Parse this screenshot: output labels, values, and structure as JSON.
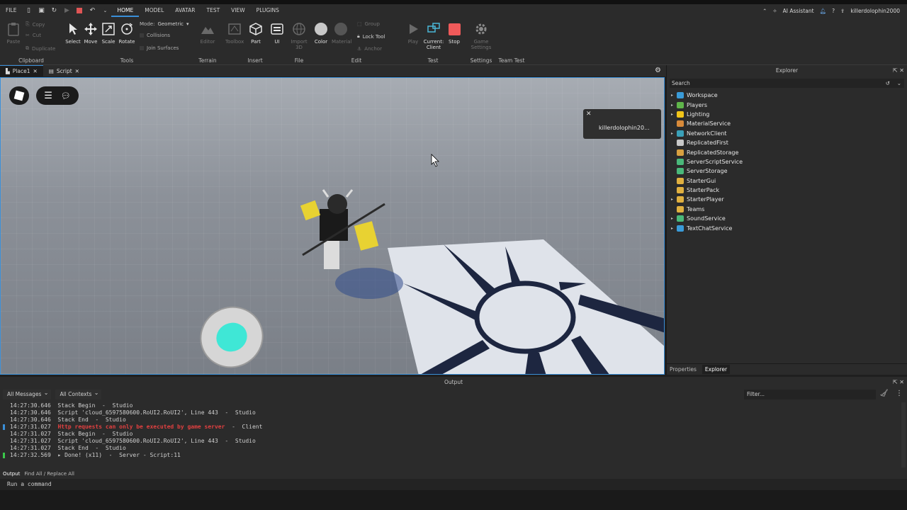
{
  "menu": {
    "file": "FILE",
    "tabs": [
      "HOME",
      "MODEL",
      "AVATAR",
      "TEST",
      "VIEW",
      "PLUGINS"
    ],
    "ai_assistant": "AI Assistant",
    "username": "killerdolophin2000"
  },
  "ribbon": {
    "clipboard": {
      "label": "Clipboard",
      "paste": "Paste",
      "copy": "Copy",
      "cut": "Cut",
      "duplicate": "Duplicate"
    },
    "tools": {
      "label": "Tools",
      "select": "Select",
      "move": "Move",
      "scale": "Scale",
      "rotate": "Rotate",
      "mode_label": "Mode:",
      "mode_value": "Geometric",
      "collisions": "Collisions",
      "join_surfaces": "Join Surfaces"
    },
    "terrain": {
      "label": "Terrain",
      "editor": "Editor"
    },
    "insert": {
      "label": "Insert",
      "toolbox": "Toolbox",
      "part": "Part",
      "ui": "UI"
    },
    "file": {
      "label": "File",
      "import3d": "Import 3D"
    },
    "edit": {
      "label": "Edit",
      "color": "Color",
      "material": "Material",
      "group": "Group",
      "lock_tool": "Lock Tool",
      "anchor": "Anchor"
    },
    "test": {
      "label": "Test",
      "play": "Play",
      "current": "Current:",
      "client": "Client",
      "stop": "Stop"
    },
    "settings": {
      "label": "Settings",
      "game_settings": "Game Settings"
    },
    "team_test": {
      "label": "Team Test"
    }
  },
  "doc_tabs": [
    {
      "label": "Place1"
    },
    {
      "label": "Script"
    }
  ],
  "viewport": {
    "player_name": "killerdolophin20..."
  },
  "explorer": {
    "title": "Explorer",
    "search_placeholder": "Search",
    "items": [
      {
        "label": "Workspace",
        "color": "#3a9bd8",
        "expandable": true
      },
      {
        "label": "Players",
        "color": "#5fb54a",
        "expandable": true
      },
      {
        "label": "Lighting",
        "color": "#f0c419",
        "expandable": true
      },
      {
        "label": "MaterialService",
        "color": "#d88a3a",
        "expandable": false
      },
      {
        "label": "NetworkClient",
        "color": "#3aa0b8",
        "expandable": true
      },
      {
        "label": "ReplicatedFirst",
        "color": "#c8c8c8",
        "expandable": false
      },
      {
        "label": "ReplicatedStorage",
        "color": "#d8a040",
        "expandable": false
      },
      {
        "label": "ServerScriptService",
        "color": "#4ab87a",
        "expandable": false
      },
      {
        "label": "ServerStorage",
        "color": "#4ab87a",
        "expandable": false
      },
      {
        "label": "StarterGui",
        "color": "#e0b040",
        "expandable": false
      },
      {
        "label": "StarterPack",
        "color": "#e0b040",
        "expandable": false
      },
      {
        "label": "StarterPlayer",
        "color": "#e0b040",
        "expandable": true
      },
      {
        "label": "Teams",
        "color": "#e0b040",
        "expandable": false
      },
      {
        "label": "SoundService",
        "color": "#4ab87a",
        "expandable": true
      },
      {
        "label": "TextChatService",
        "color": "#3a9bd8",
        "expandable": true
      }
    ],
    "tabs": {
      "properties": "Properties",
      "explorer": "Explorer"
    }
  },
  "output": {
    "title": "Output",
    "all_messages": "All Messages",
    "all_contexts": "All Contexts",
    "filter_placeholder": "Filter...",
    "lines": [
      {
        "text": "14:27:30.646  Stack Begin  -  Studio",
        "type": "stack",
        "marker": ""
      },
      {
        "text": "14:27:30.646  Script 'cloud_6597580600.RoUI2.RoUI2', Line 443  -  Studio",
        "type": "stack",
        "marker": ""
      },
      {
        "text": "14:27:30.646  Stack End  -  Studio",
        "type": "stack",
        "marker": ""
      },
      {
        "text": "14:27:31.027  ",
        "err": "Http requests can only be executed by game server",
        "suffix": "  -  Client",
        "type": "error",
        "marker": "#3a8fd8"
      },
      {
        "text": "14:27:31.027  Stack Begin  -  Studio",
        "type": "stack",
        "marker": ""
      },
      {
        "text": "14:27:31.027  Script 'cloud_6597580600.RoUI2.RoUI2', Line 443  -  Studio",
        "type": "stack",
        "marker": ""
      },
      {
        "text": "14:27:31.027  Stack End  -  Studio",
        "type": "stack",
        "marker": ""
      },
      {
        "text": "14:27:32.569  ▸ Done! (x11)  -  Server - Script:11",
        "type": "info",
        "marker": "#3ac84a"
      }
    ],
    "bottom_tabs": [
      "Output",
      "Find All / Replace All"
    ],
    "command_placeholder": "Run a command"
  }
}
